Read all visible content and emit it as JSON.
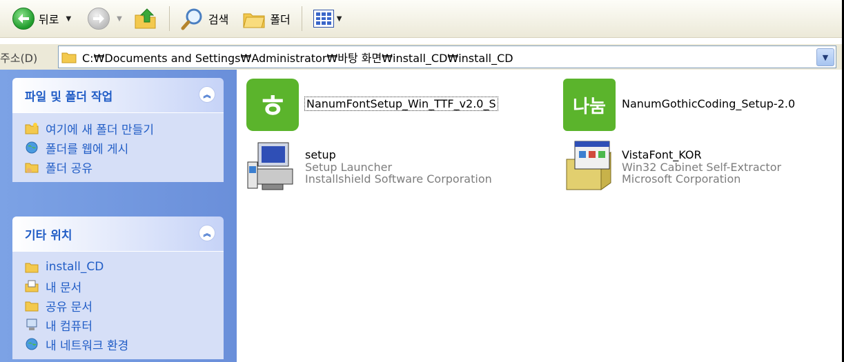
{
  "toolbar": {
    "back_label": "뒤로",
    "search_label": "검색",
    "folders_label": "폴더"
  },
  "address": {
    "label": "주소(D)",
    "path": "C:₩Documents and Settings₩Administrator₩바탕 화면₩install_CD₩install_CD"
  },
  "taskpane": {
    "file_tasks": {
      "title": "파일 및 폴더 작업",
      "items": [
        {
          "label": "여기에 새 폴더 만들기",
          "icon": "new-folder-icon"
        },
        {
          "label": "폴더를 웹에 게시",
          "icon": "publish-web-icon"
        },
        {
          "label": "폴더 공유",
          "icon": "share-folder-icon"
        }
      ]
    },
    "other_places": {
      "title": "기타 위치",
      "items": [
        {
          "label": "install_CD",
          "icon": "folder-icon"
        },
        {
          "label": "내 문서",
          "icon": "my-documents-icon"
        },
        {
          "label": "공유 문서",
          "icon": "folder-icon"
        },
        {
          "label": "내 컴퓨터",
          "icon": "my-computer-icon"
        },
        {
          "label": "내 네트워크 환경",
          "icon": "network-icon"
        }
      ]
    }
  },
  "files": [
    {
      "name": "NanumFontSetup_Win_TTF_v2.0_S",
      "lines": [],
      "icon": "nanum-font-setup-icon",
      "selected": true,
      "glyph": "ㅎ"
    },
    {
      "name": "NanumGothicCoding_Setup-2.0",
      "lines": [],
      "icon": "nanum-gothic-coding-icon",
      "selected": false,
      "glyph": "나눔"
    },
    {
      "name": "setup",
      "lines": [
        "Setup Launcher",
        "Installshield Software Corporation"
      ],
      "icon": "setup-launcher-icon",
      "selected": false
    },
    {
      "name": "VistaFont_KOR",
      "lines": [
        "Win32 Cabinet Self-Extractor",
        "Microsoft Corporation"
      ],
      "icon": "cabinet-extractor-icon",
      "selected": false
    }
  ],
  "colors": {
    "taskpane_bg": "#7ca2e5",
    "panel_title": "#215dc6",
    "panel_body": "#d6dff7",
    "nanum_green": "#5bb42c"
  }
}
